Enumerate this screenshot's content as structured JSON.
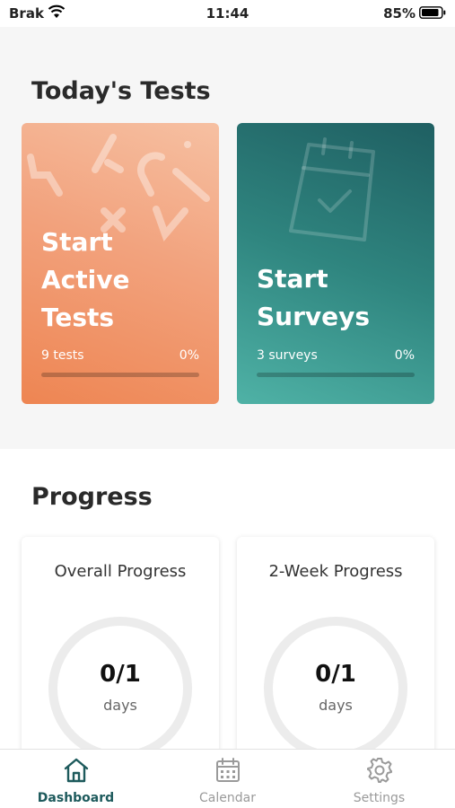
{
  "status_bar": {
    "carrier": "Brak",
    "time": "11:44",
    "battery": "85%"
  },
  "tests": {
    "title": "Today's Tests",
    "cards": [
      {
        "title": "Start Active Tests",
        "count": "9 tests",
        "percent": "0%",
        "progress": 0
      },
      {
        "title": "Start Surveys",
        "count": "3 surveys",
        "percent": "0%",
        "progress": 0
      }
    ]
  },
  "progress": {
    "title": "Progress",
    "cards": [
      {
        "title": "Overall Progress",
        "value": "0/1",
        "unit": "days"
      },
      {
        "title": "2-Week Progress",
        "value": "0/1",
        "unit": "days"
      }
    ]
  },
  "tab_bar": {
    "items": [
      {
        "label": "Dashboard",
        "icon": "home-icon",
        "active": true
      },
      {
        "label": "Calendar",
        "icon": "calendar-icon",
        "active": false
      },
      {
        "label": "Settings",
        "icon": "gear-icon",
        "active": false
      }
    ]
  },
  "colors": {
    "active_card": "#ee8552",
    "survey_card": "#2f857f",
    "tab_active": "#1d5a5c",
    "tab_inactive": "#9a9a9a"
  }
}
